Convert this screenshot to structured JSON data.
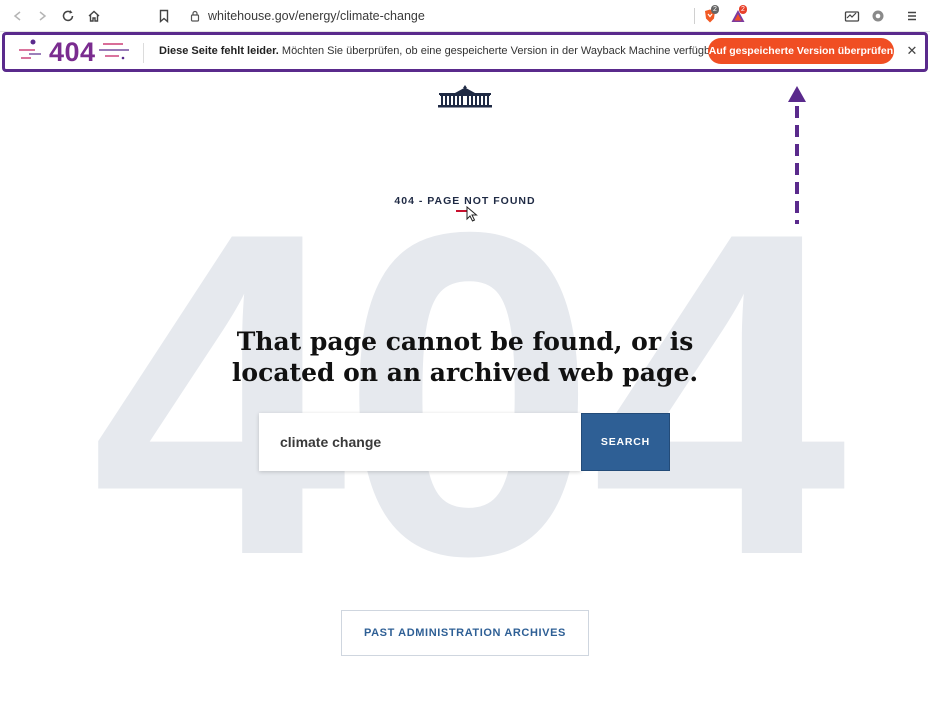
{
  "browser": {
    "url": "whitehouse.gov/energy/climate-change",
    "brave_badge_count": "2",
    "rewards_badge_count": "2"
  },
  "notification": {
    "logo_text": "404",
    "bold_text": "Diese Seite fehlt leider.",
    "message": " Möchten Sie überprüfen, ob eine gespeicherte Version in der Wayback Machine verfügbar ist?",
    "button_label": "Auf gespeicherte Version überprüfen",
    "close_label": "✕",
    "border_color": "#5a2a8c",
    "button_color": "#f04e23"
  },
  "page": {
    "background_number": "404",
    "kicker": "404 - PAGE NOT FOUND",
    "headline_line1": "That page cannot be found, or is",
    "headline_line2": "located on an archived web page.",
    "search_value": "climate change",
    "search_button": "SEARCH",
    "archives_button": "PAST ADMINISTRATION ARCHIVES",
    "accent_color": "#2e5f95"
  }
}
